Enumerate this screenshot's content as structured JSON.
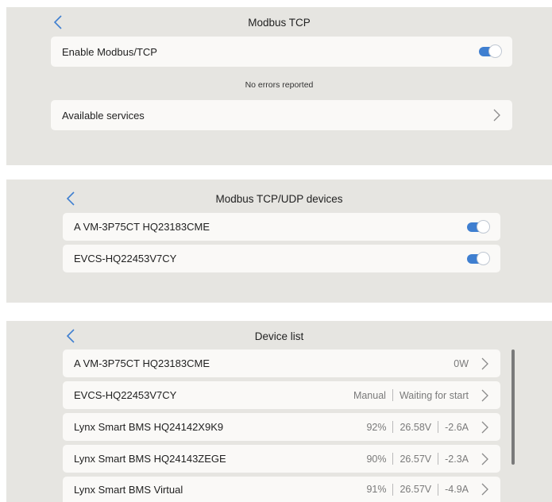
{
  "colors": {
    "panel_bg": "#e6e5e1",
    "row_bg": "#faf9f7",
    "accent": "#3f7fd0",
    "muted_text": "#7a7a7a"
  },
  "modbus_tcp": {
    "title": "Modbus TCP",
    "back_icon": "chevron-left-icon",
    "enable": {
      "label": "Enable Modbus/TCP",
      "enabled": true
    },
    "status": "No errors reported",
    "services": {
      "label": "Available services",
      "icon": "chevron-right-icon"
    }
  },
  "devices": {
    "title": "Modbus TCP/UDP devices",
    "back_icon": "chevron-left-icon",
    "items": [
      {
        "label": "A VM-3P75CT HQ23183CME",
        "enabled": true
      },
      {
        "label": "EVCS-HQ22453V7CY",
        "enabled": true
      }
    ]
  },
  "device_list": {
    "title": "Device list",
    "back_icon": "chevron-left-icon",
    "items": [
      {
        "name": "A VM-3P75CT HQ23183CME",
        "values": [
          "0W"
        ]
      },
      {
        "name": "EVCS-HQ22453V7CY",
        "values": [
          "Manual",
          "Waiting for start"
        ]
      },
      {
        "name": "Lynx Smart BMS HQ24142X9K9",
        "values": [
          "92%",
          "26.58V",
          "-2.6A"
        ]
      },
      {
        "name": "Lynx Smart BMS HQ24143ZEGE",
        "values": [
          "90%",
          "26.57V",
          "-2.3A"
        ]
      },
      {
        "name": "Lynx Smart BMS Virtual",
        "values": [
          "91%",
          "26.57V",
          "-4.9A"
        ]
      }
    ]
  }
}
